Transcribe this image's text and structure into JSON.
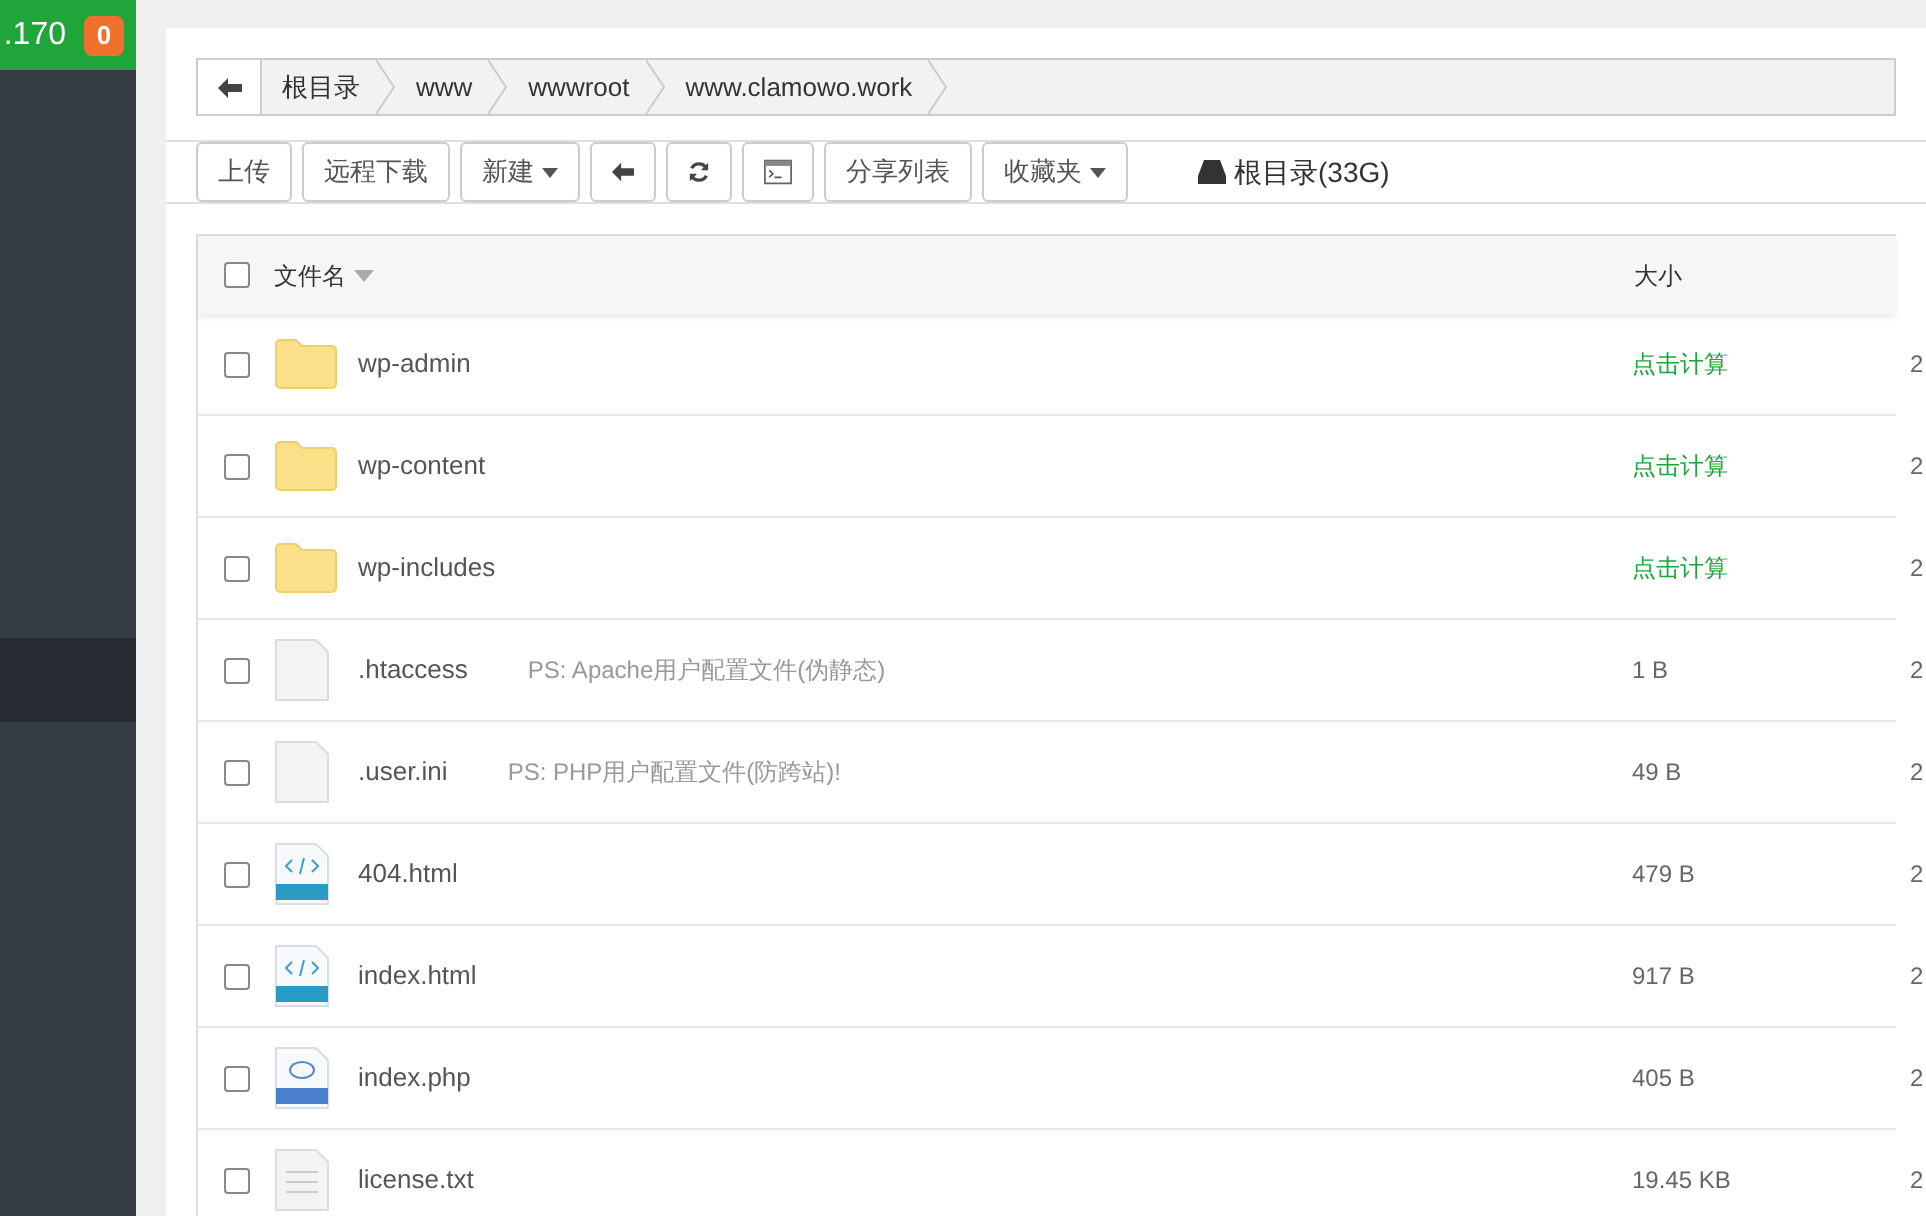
{
  "sidebar": {
    "server_ip": ".170",
    "badge": "0",
    "items": [
      {
        "selected": true
      }
    ]
  },
  "breadcrumb": [
    "根目录",
    "www",
    "wwwroot",
    "www.clamowo.work"
  ],
  "toolbar": [
    {
      "kind": "text",
      "label": "上传"
    },
    {
      "kind": "text",
      "label": "远程下载"
    },
    {
      "kind": "dropdown",
      "label": "新建"
    },
    {
      "kind": "back"
    },
    {
      "kind": "refresh"
    },
    {
      "kind": "terminal"
    },
    {
      "kind": "text",
      "label": "分享列表"
    },
    {
      "kind": "dropdown",
      "label": "收藏夹"
    }
  ],
  "disk": "根目录(33G)",
  "table": {
    "columns": [
      "文件名",
      "大小"
    ],
    "all_checked": false,
    "rows": [
      {
        "kind": "folder",
        "name": "wp-admin",
        "checked": false,
        "size": "点击计算",
        "size_action": true,
        "column_3": "2"
      },
      {
        "kind": "folder",
        "name": "wp-content",
        "checked": false,
        "size": "点击计算",
        "size_action": true,
        "column_3": "2"
      },
      {
        "kind": "folder",
        "name": "wp-includes",
        "checked": false,
        "size": "点击计算",
        "size_action": true,
        "column_3": "2"
      },
      {
        "kind": "blank",
        "name": ".htaccess",
        "checked": false,
        "note": "PS: Apache用户配置文件(伪静态)",
        "size": "1 B",
        "size_action": false,
        "column_3": "2"
      },
      {
        "kind": "blank",
        "name": ".user.ini",
        "checked": false,
        "note": "PS: PHP用户配置文件(防跨站)!",
        "size": "49 B",
        "size_action": false,
        "column_3": "2"
      },
      {
        "kind": "html",
        "name": "404.html",
        "checked": false,
        "size": "479 B",
        "size_action": false,
        "column_3": "2"
      },
      {
        "kind": "html",
        "name": "index.html",
        "checked": false,
        "size": "917 B",
        "size_action": false,
        "column_3": "2"
      },
      {
        "kind": "php",
        "name": "index.php",
        "checked": false,
        "size": "405 B",
        "size_action": false,
        "column_3": "2"
      },
      {
        "kind": "text",
        "name": "license.txt",
        "checked": false,
        "size": "19.45 KB",
        "size_action": false,
        "column_3": "2"
      }
    ]
  }
}
